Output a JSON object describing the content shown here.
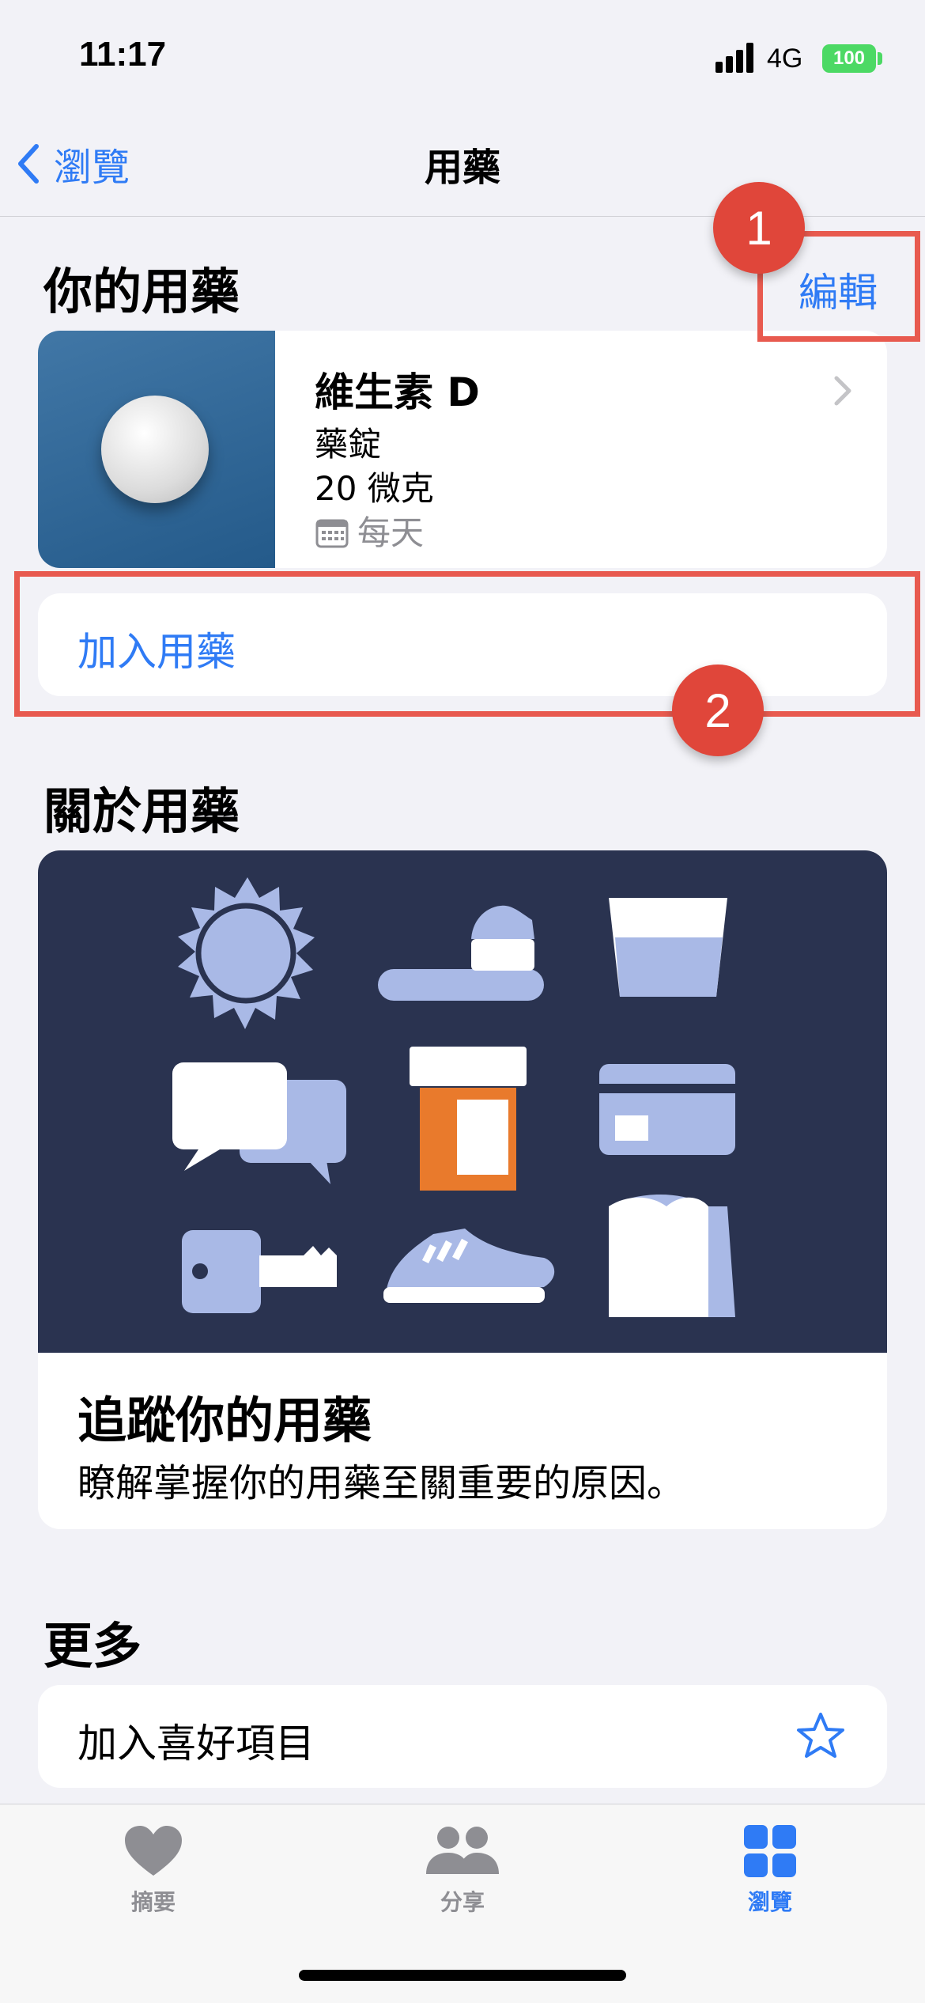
{
  "status_bar": {
    "time": "11:17",
    "network": "4G",
    "battery": "100"
  },
  "nav": {
    "back_label": "瀏覽",
    "title": "用藥"
  },
  "your_meds": {
    "header": "你的用藥",
    "edit_label": "編輯",
    "medication": {
      "name": "維生素 D",
      "form": "藥錠",
      "dose": "20 微克",
      "schedule": "每天"
    },
    "add_label": "加入用藥"
  },
  "annotations": {
    "badge1": "1",
    "badge2": "2",
    "color": "#e0463a"
  },
  "about": {
    "header": "關於用藥",
    "card_title": "追蹤你的用藥",
    "card_subtitle": "瞭解掌握你的用藥至關重要的原因。"
  },
  "more": {
    "header": "更多",
    "favorite_label": "加入喜好項目"
  },
  "tab_bar": {
    "tabs": [
      {
        "label": "摘要",
        "icon": "heart-icon",
        "active": false
      },
      {
        "label": "分享",
        "icon": "people-icon",
        "active": false
      },
      {
        "label": "瀏覽",
        "icon": "grid-icon",
        "active": true
      }
    ]
  },
  "colors": {
    "accent": "#2f7bf5",
    "background": "#f2f2f7",
    "annotation": "#e85a4f"
  }
}
